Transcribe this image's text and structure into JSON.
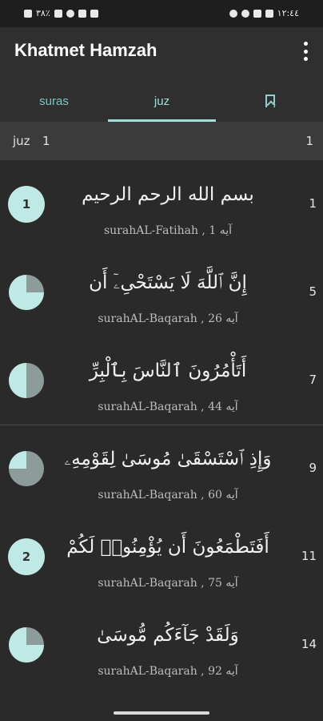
{
  "status": {
    "left_text": "٣٨٪",
    "time": "١٢:٤٤"
  },
  "appbar": {
    "title": "Khatmet Hamzah"
  },
  "tabs": [
    {
      "label": "suras"
    },
    {
      "label": "juz"
    },
    {
      "icon": "bookmark-icon"
    }
  ],
  "section": {
    "label": "juz",
    "number": "1",
    "page": "1"
  },
  "items": [
    {
      "ayah_text": "بسم الله الرحم الرحيم",
      "surah": "surahAL-Fatihah",
      "ayah_label": "آيه",
      "ayah_number": "1",
      "page": "1",
      "marker": "circle",
      "marker_label": "1",
      "progress": 0
    },
    {
      "ayah_text": "إِنَّ ٱللَّهَ لَا يَسْتَحْىِۦٓ أَن",
      "surah": "surahAL-Baqarah",
      "ayah_label": "آيه",
      "ayah_number": "26",
      "page": "5",
      "marker": "pie",
      "progress": 0.25
    },
    {
      "ayah_text": "أَتَأْمُرُونَ ٱلنَّاسَ بِٱلْبِرِّ",
      "surah": "surahAL-Baqarah",
      "ayah_label": "آيه",
      "ayah_number": "44",
      "page": "7",
      "marker": "pie",
      "progress": 0.5
    },
    {
      "ayah_text": "وَإِذِ ٱسْتَسْقَىٰ مُوسَىٰ لِقَوْمِهِۦ",
      "surah": "surahAL-Baqarah",
      "ayah_label": "آيه",
      "ayah_number": "60",
      "page": "9",
      "marker": "pie",
      "progress": 0.75
    },
    {
      "ayah_text": "أَفَتَطْمَعُونَ أَن يُؤْمِنُوا۟ لَكُمْ",
      "surah": "surahAL-Baqarah",
      "ayah_label": "آيه",
      "ayah_number": "75",
      "page": "11",
      "marker": "circle",
      "marker_label": "2",
      "progress": 0
    },
    {
      "ayah_text": "وَلَقَدْ جَآءَكُم مُّوسَىٰ",
      "surah": "surahAL-Baqarah",
      "ayah_label": "آيه",
      "ayah_number": "92",
      "page": "14",
      "marker": "pie",
      "progress": 0.25
    }
  ],
  "colors": {
    "accent": "#9ee0db",
    "pie_fill": "#bfe9e4",
    "pie_empty": "#8c9c9a",
    "background": "#2a2a2a"
  }
}
